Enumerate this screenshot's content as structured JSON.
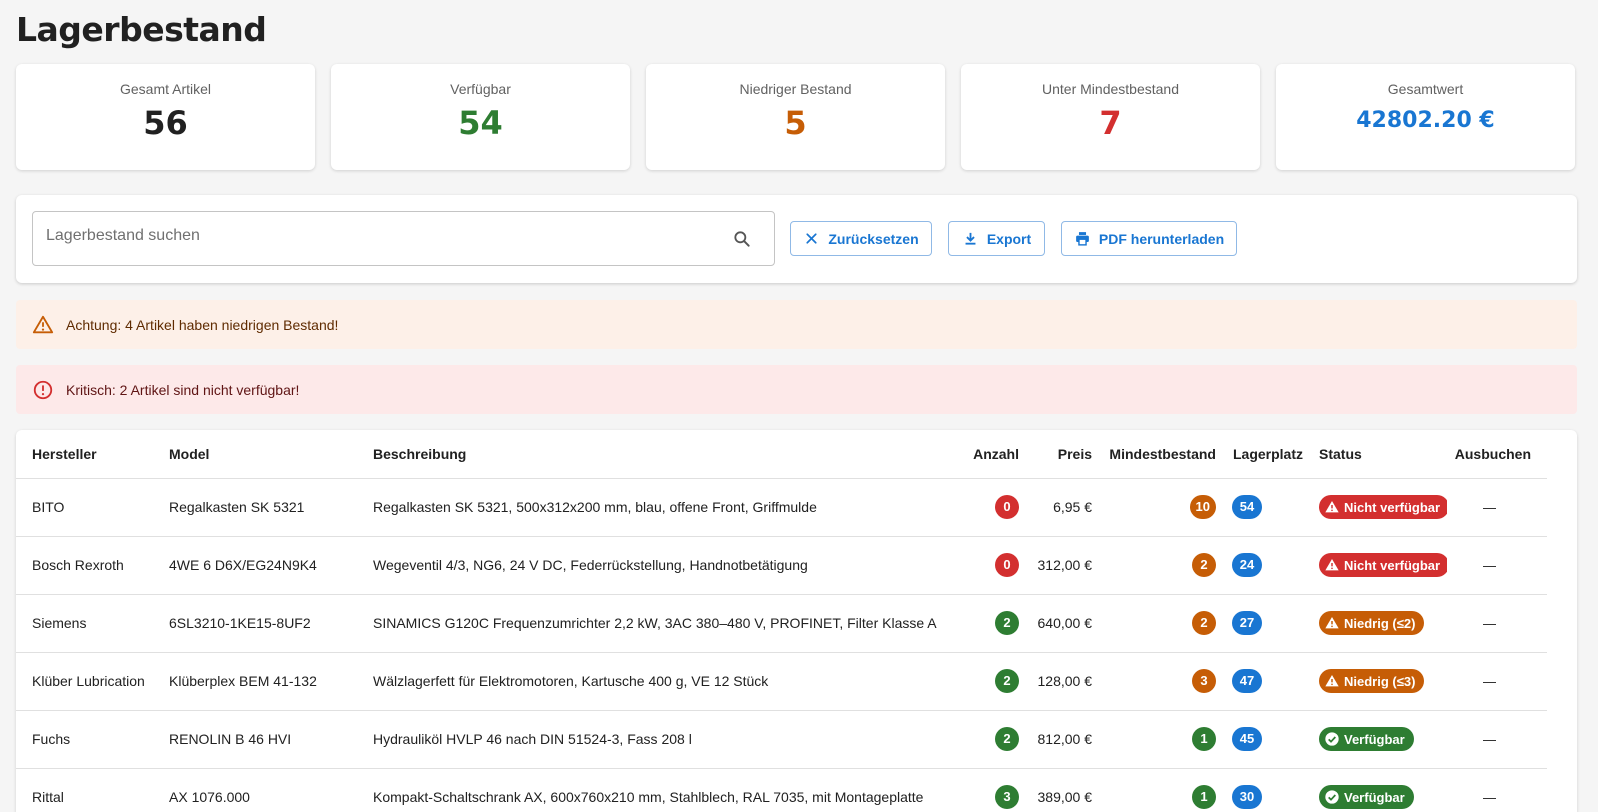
{
  "page_title": "Lagerbestand",
  "stats": [
    {
      "label": "Gesamt Artikel",
      "value": "56",
      "color": "#212121"
    },
    {
      "label": "Verfügbar",
      "value": "54",
      "color": "#2e7d32"
    },
    {
      "label": "Niedriger Bestand",
      "value": "5",
      "color": "#c65d06"
    },
    {
      "label": "Unter Mindestbestand",
      "value": "7",
      "color": "#d32f2f"
    },
    {
      "label": "Gesamtwert",
      "value": "42802.20 €",
      "color": "#1976d2"
    }
  ],
  "toolbar": {
    "search_placeholder": "Lagerbestand suchen",
    "search_value": "",
    "reset_label": "Zurücksetzen",
    "export_label": "Export",
    "pdf_label": "PDF herunterladen"
  },
  "alerts": {
    "warning": "Achtung: 4 Artikel haben niedrigen Bestand!",
    "error": "Kritisch: 2 Artikel sind nicht verfügbar!"
  },
  "table": {
    "headers": [
      "Hersteller",
      "Model",
      "Beschreibung",
      "Anzahl",
      "Preis",
      "Mindestbestand",
      "Lagerplatz",
      "Status",
      "Ausbuchen"
    ],
    "rows": [
      {
        "manufacturer": "BITO",
        "model": "Regalkasten SK 5321",
        "description": "Regalkasten SK 5321, 500x312x200 mm, blau, offene Front, Griffmulde",
        "qty": "0",
        "qty_color": "red",
        "price": "6,95 €",
        "min": "10",
        "min_color": "orange",
        "location": "54",
        "status": "Nicht verfügbar",
        "status_type": "error",
        "action": "—"
      },
      {
        "manufacturer": "Bosch Rexroth",
        "model": "4WE 6 D6X/EG24N9K4",
        "description": "Wegeventil 4/3, NG6, 24 V DC, Federrückstellung, Handnotbetätigung",
        "qty": "0",
        "qty_color": "red",
        "price": "312,00 €",
        "min": "2",
        "min_color": "orange",
        "location": "24",
        "status": "Nicht verfügbar",
        "status_type": "error",
        "action": "—"
      },
      {
        "manufacturer": "Siemens",
        "model": "6SL3210-1KE15-8UF2",
        "description": "SINAMICS G120C Frequenzumrichter 2,2 kW, 3AC 380–480 V, PROFINET, Filter Klasse A",
        "qty": "2",
        "qty_color": "green",
        "price": "640,00 €",
        "min": "2",
        "min_color": "orange",
        "location": "27",
        "status": "Niedrig (≤2)",
        "status_type": "warning",
        "action": "—"
      },
      {
        "manufacturer": "Klüber Lubrication",
        "model": "Klüberplex BEM 41-132",
        "description": "Wälzlagerfett für Elektromotoren, Kartusche 400 g, VE 12 Stück",
        "qty": "2",
        "qty_color": "green",
        "price": "128,00 €",
        "min": "3",
        "min_color": "orange",
        "location": "47",
        "status": "Niedrig (≤3)",
        "status_type": "warning",
        "action": "—"
      },
      {
        "manufacturer": "Fuchs",
        "model": "RENOLIN B 46 HVI",
        "description": "Hydrauliköl HVLP 46 nach DIN 51524-3, Fass 208 l",
        "qty": "2",
        "qty_color": "green",
        "price": "812,00 €",
        "min": "1",
        "min_color": "green",
        "location": "45",
        "status": "Verfügbar",
        "status_type": "ok",
        "action": "—"
      },
      {
        "manufacturer": "Rittal",
        "model": "AX 1076.000",
        "description": "Kompakt-Schaltschrank AX, 600x760x210 mm, Stahlblech, RAL 7035, mit Montageplatte",
        "qty": "3",
        "qty_color": "green",
        "price": "389,00 €",
        "min": "1",
        "min_color": "green",
        "location": "30",
        "status": "Verfügbar",
        "status_type": "ok",
        "action": "—"
      }
    ]
  }
}
